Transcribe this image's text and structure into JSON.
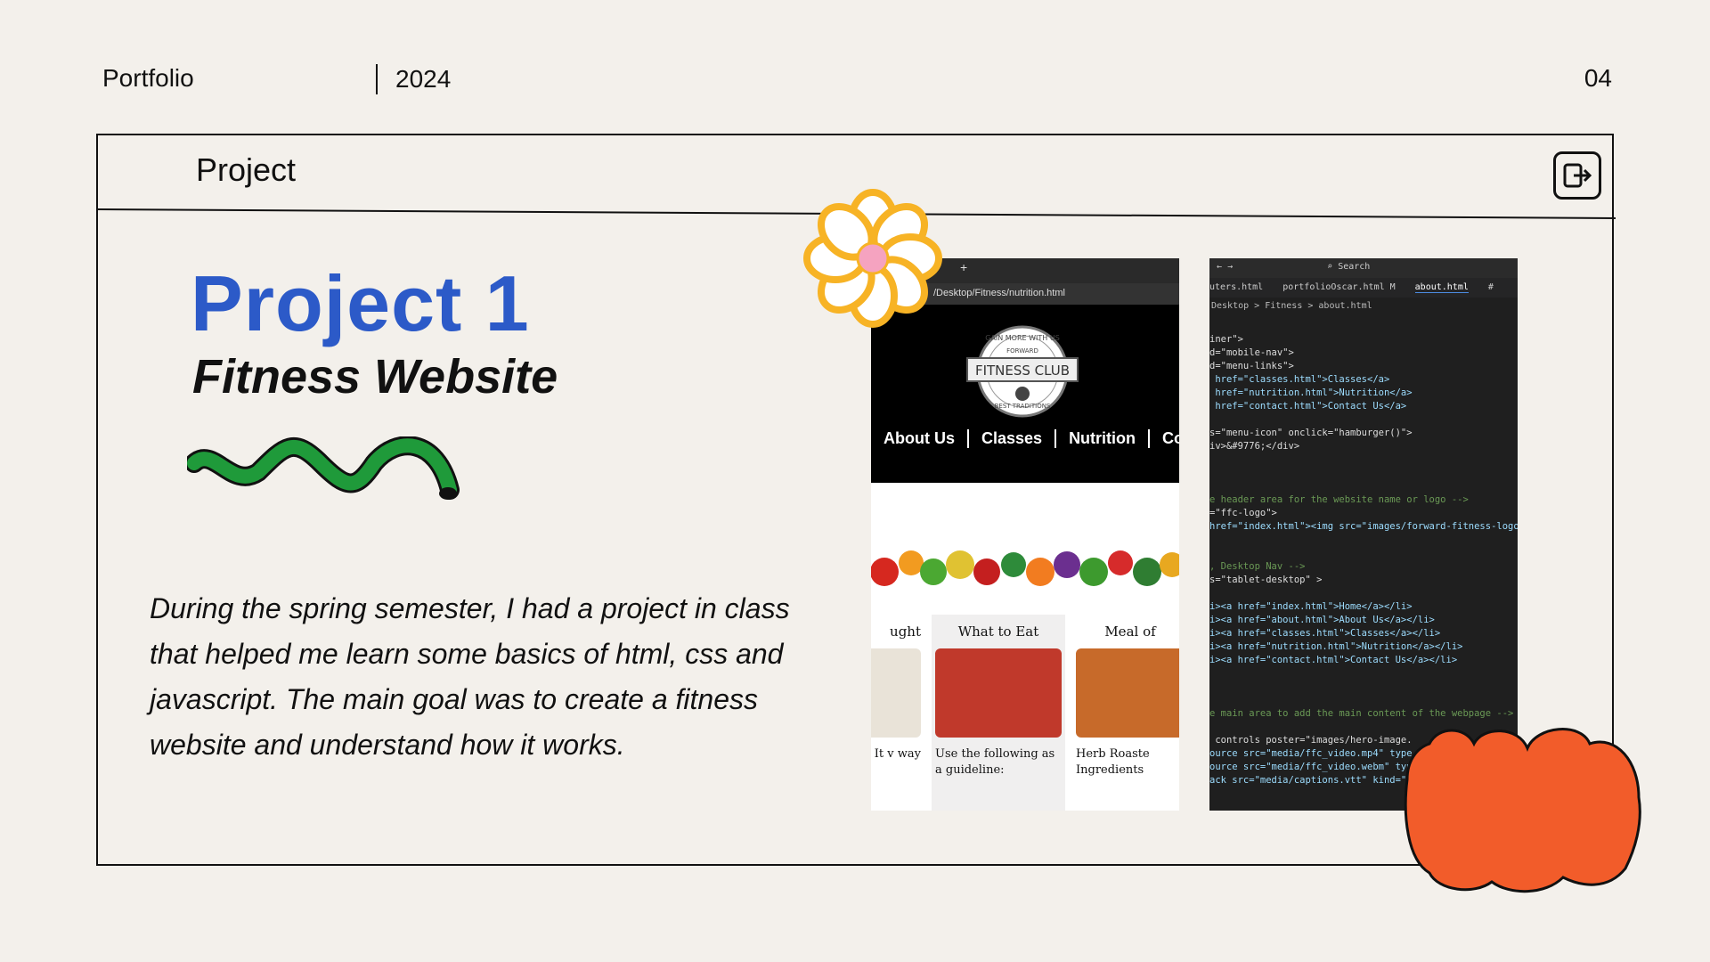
{
  "header": {
    "portfolio": "Portfolio",
    "year": "2024",
    "page_number": "04",
    "section_label": "Project"
  },
  "project": {
    "title": "Project 1",
    "subtitle": "Fitness Website",
    "description": "During the spring semester, I had a project in class that helped me learn some basics of html, css and javascript. The main goal was to create a fitness website and understand how it works."
  },
  "browser": {
    "tab_plus": "+",
    "address": "/Desktop/Fitness/nutrition.html",
    "logo_top": "GAIN MORE WITH US",
    "logo_forward": "FORWARD",
    "logo_main": "FITNESS CLUB",
    "logo_bottom": "BEST TRADITIONS",
    "nav": [
      "About Us",
      "Classes",
      "Nutrition",
      "Conta"
    ],
    "cards": [
      {
        "title": "ught",
        "text": "a et. It v way"
      },
      {
        "title": "What to Eat",
        "text": "Use the following as a guideline:"
      },
      {
        "title": "Meal of",
        "text": "Herb Roaste Ingredients"
      }
    ]
  },
  "editor": {
    "search": "Search",
    "tabs": [
      "uters.html",
      "portfolioOscar.html M",
      "about.html",
      "#"
    ],
    "breadcrumb": "Desktop > Fitness > about.html",
    "code_lines": [
      "iner\">",
      "d=\"mobile-nav\">",
      "d=\"menu-links\">",
      " href=\"classes.html\">Classes</a>",
      " href=\"nutrition.html\">Nutrition</a>",
      " href=\"contact.html\">Contact Us</a>",
      "",
      "s=\"menu-icon\" onclick=\"hamburger()\">",
      "iv>&#9776;</div>",
      "",
      "",
      "",
      "e header area for the website name or logo -->",
      "=\"ffc-logo\">",
      "href=\"index.html\"><img src=\"images/forward-fitness-logo.pn",
      "",
      "",
      ", Desktop Nav -->",
      "s=\"tablet-desktop\" >",
      "",
      "i><a href=\"index.html\">Home</a></li>",
      "i><a href=\"about.html\">About Us</a></li>",
      "i><a href=\"classes.html\">Classes</a></li>",
      "i><a href=\"nutrition.html\">Nutrition</a></li>",
      "i><a href=\"contact.html\">Contact Us</a></li>",
      "",
      "",
      "",
      "e main area to add the main content of the webpage -->",
      "",
      " controls poster=\"images/hero-image.",
      "ource src=\"media/ffc_video.mp4\" type",
      "ource src=\"media/ffc_video.webm\" type",
      "ack src=\"media/captions.vtt\" kind=\""
    ]
  },
  "colors": {
    "accent": "#2c5ac8",
    "background": "#f3f0eb",
    "squiggle": "#1f9a3a",
    "flower": "#f7b325",
    "blob": "#f25c2a"
  }
}
